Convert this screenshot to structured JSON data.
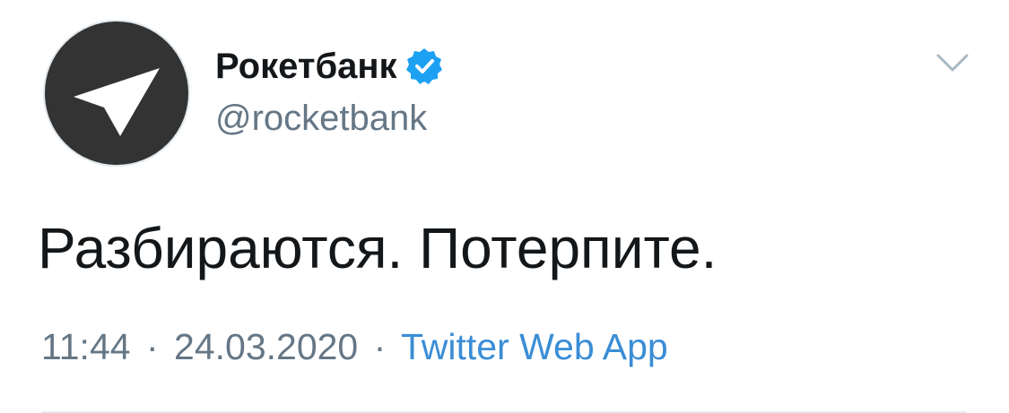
{
  "tweet": {
    "author": {
      "display_name": "Рокетбанк",
      "handle": "@rocketbank",
      "verified": true,
      "avatar_icon": "paper-plane-arrow-icon",
      "avatar_bg": "#333333"
    },
    "text": "Разбираются. Потерпите.",
    "time": "11:44",
    "date": "24.03.2020",
    "separator": "·",
    "source": "Twitter Web App",
    "colors": {
      "text": "#14171a",
      "secondary": "#657786",
      "link": "#3a8dd6",
      "verified": "#1da1f2"
    },
    "menu_icon": "chevron-down-icon"
  }
}
